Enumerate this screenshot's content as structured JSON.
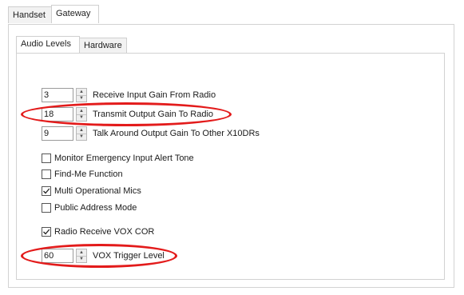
{
  "outer_tabs": [
    "Handset",
    "Gateway"
  ],
  "inner_tabs": [
    "Audio Levels",
    "Hardware"
  ],
  "spinners": [
    {
      "value": "3",
      "label": "Receive Input Gain From Radio"
    },
    {
      "value": "18",
      "label": "Transmit Output Gain To Radio"
    },
    {
      "value": "9",
      "label": "Talk Around Output Gain To Other X10DRs"
    }
  ],
  "checkboxes": [
    {
      "label": "Monitor Emergency Input Alert Tone",
      "checked": false
    },
    {
      "label": "Find-Me Function",
      "checked": false
    },
    {
      "label": "Multi Operational Mics",
      "checked": true
    },
    {
      "label": "Public Address Mode",
      "checked": false
    },
    {
      "label": "Radio Receive VOX COR",
      "checked": true
    }
  ],
  "vox": {
    "value": "60",
    "label": "VOX Trigger Level"
  },
  "colors": {
    "highlight": "#e31b1b"
  }
}
